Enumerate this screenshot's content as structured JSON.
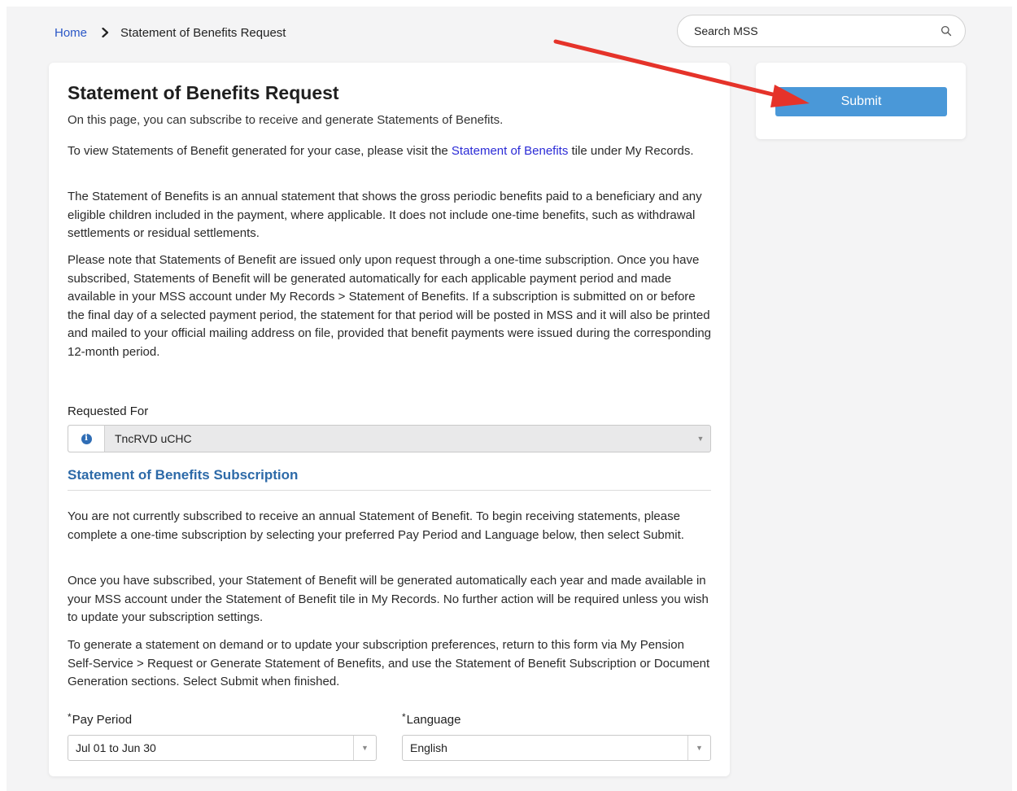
{
  "breadcrumb": {
    "home": "Home",
    "current": "Statement of Benefits Request"
  },
  "search": {
    "placeholder": "Search MSS"
  },
  "main": {
    "title": "Statement of Benefits Request",
    "subtitle": "On this page, you can subscribe to receive and generate Statements of Benefits.",
    "visit_prefix": "To view Statements of Benefit generated for your case, please visit the ",
    "visit_link": "Statement of Benefits",
    "visit_suffix": " tile under My Records.",
    "para1": "The Statement of Benefits is an annual statement that shows the gross periodic benefits paid to a beneficiary and any eligible children included in the payment, where applicable. It does not include one-time benefits, such as withdrawal settlements or residual settlements.",
    "para2": "Please note that Statements of Benefit are issued only upon request through a one-time subscription. Once you have subscribed, Statements of Benefit will be generated automatically for each applicable payment period and made available in your MSS account under My Records > Statement of Benefits. If a subscription is submitted on or before the final day of a selected payment period, the statement for that period will be posted in MSS and it will also be printed and mailed to your official mailing address on file, provided that benefit payments were issued during the corresponding 12-month period.",
    "requested_for_label": "Requested For",
    "requested_for_value": "TncRVD uCHC"
  },
  "subscription": {
    "title": "Statement of Benefits Subscription",
    "para1": "You are not currently subscribed to receive an annual Statement of Benefit. To begin receiving statements, please complete a one-time subscription by selecting your preferred Pay Period and Language below, then select Submit.",
    "para2": "Once you have subscribed, your Statement of Benefit will be generated automatically each year and made available in your MSS account under the Statement of Benefit tile in My Records. No further action will be required unless you wish to update your subscription settings.",
    "para3": "To generate a statement on demand or to update your subscription preferences, return to this form via My Pension Self-Service > Request or Generate Statement of Benefits, and use the Statement of Benefit Subscription or Document Generation sections. Select Submit when finished.",
    "required_mark": "*",
    "pay_period_label": "Pay Period",
    "pay_period_value": "Jul 01 to Jun 30",
    "language_label": "Language",
    "language_value": "English"
  },
  "actions": {
    "submit_label": "Submit"
  },
  "icons": {
    "breadcrumb_separator": "chevron-right-icon",
    "search": "search-icon",
    "info": "info-icon",
    "dropdown": "caret-down-icon",
    "annotation": "red-arrow"
  },
  "colors": {
    "link": "#2a57c7",
    "section_title": "#2d6aa8",
    "submit_button": "#4a98d8",
    "annotation_arrow": "#e5332a",
    "info_icon": "#2f6db5"
  }
}
